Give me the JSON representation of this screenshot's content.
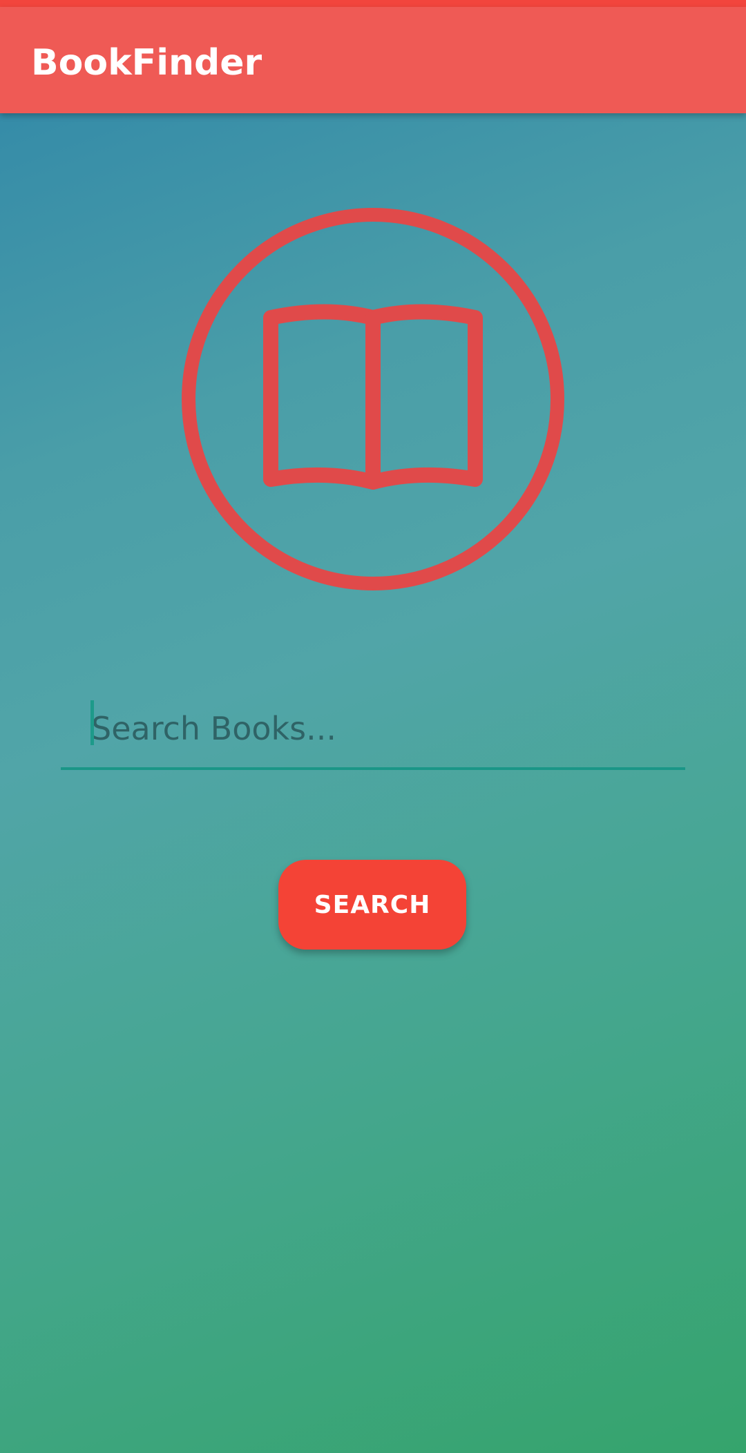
{
  "app_bar": {
    "title": "BookFinder"
  },
  "hero": {
    "icon": "book-open-icon",
    "color": "#e04a4a"
  },
  "search": {
    "value": "",
    "placeholder": "Search Books...",
    "button_label": "SEARCH"
  },
  "colors": {
    "accent": "#f44336",
    "app_bar": "#ef5a55",
    "input_underline": "#1a9687"
  }
}
